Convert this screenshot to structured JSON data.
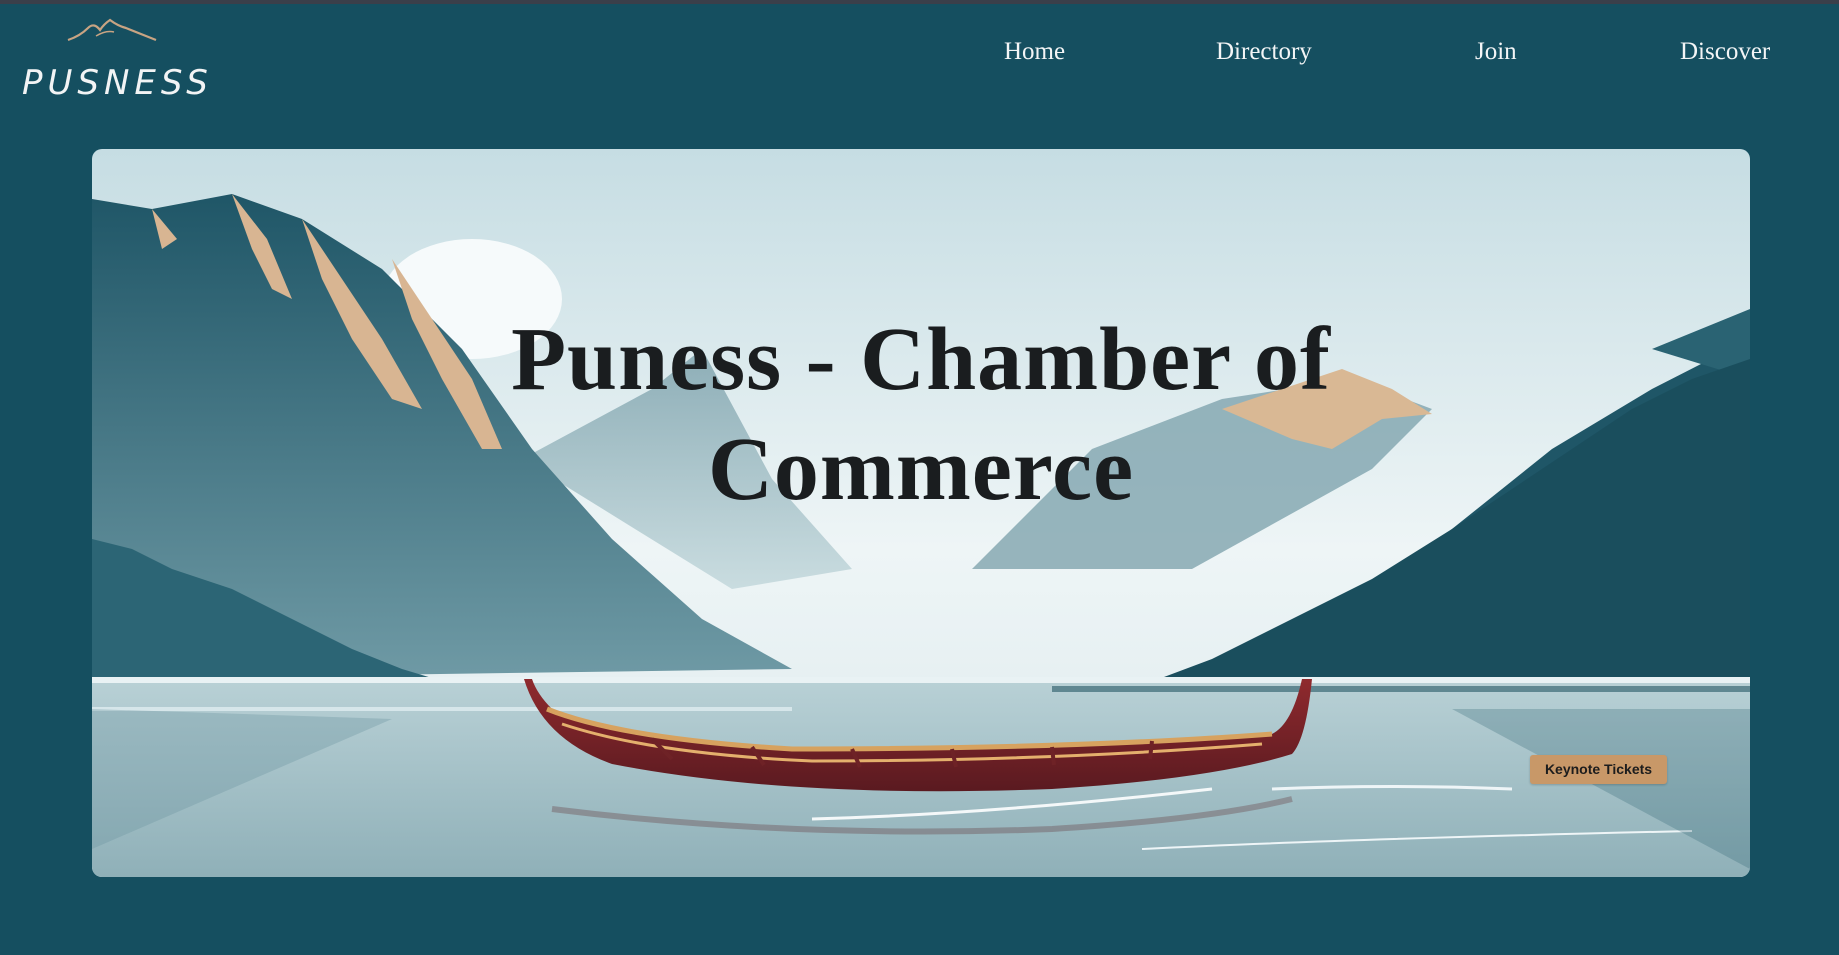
{
  "brand": {
    "name": "PUSNESS",
    "logo_icon": "mountain-icon"
  },
  "nav": {
    "items": [
      {
        "label": "Home"
      },
      {
        "label": "Directory"
      },
      {
        "label": "Join"
      },
      {
        "label": "Discover"
      }
    ]
  },
  "hero": {
    "title_line1": "Puness - Chamber of",
    "title_line2": "Commerce",
    "button_label": "Keynote Tickets",
    "image": "mountain-lake-canoe-illustration"
  },
  "colors": {
    "page_background": "#154f60",
    "nav_text": "#f3f5f6",
    "title_text": "#1a1d1f",
    "button_background": "#c89868"
  }
}
